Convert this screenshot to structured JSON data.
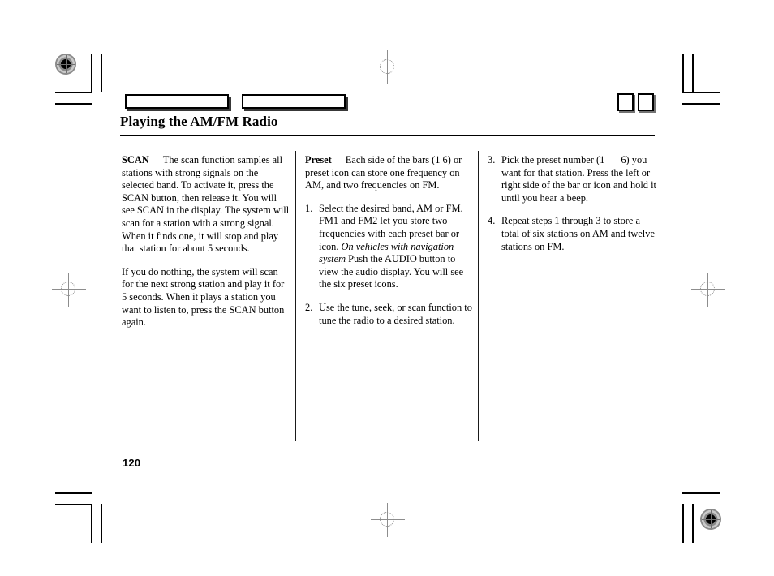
{
  "document": {
    "page_number": "120",
    "header": {
      "title": "Playing the AM/FM Radio",
      "tab_bars": [
        "",
        ""
      ],
      "corner_boxes": [
        "",
        ""
      ]
    }
  },
  "columns": [
    {
      "id": "column-1",
      "blocks": [
        {
          "type": "lead-paragraph",
          "lead": "SCAN",
          "text": "The scan function samples all stations with strong signals on the selected band. To activate it, press the SCAN button, then release it. You will see SCAN in the display. The system will scan for a station with a strong signal. When it finds one, it will stop and play that station for about 5 seconds."
        },
        {
          "type": "paragraph",
          "text": "If you do nothing, the system will scan for the next strong station and play it for 5 seconds. When it plays a station you want to listen to, press the SCAN button again."
        }
      ]
    },
    {
      "id": "column-2",
      "blocks": [
        {
          "type": "lead-paragraph",
          "lead": "Preset",
          "text": "Each side of the bars (1       6) or preset icon can store one frequency on AM, and two frequencies on FM."
        },
        {
          "type": "numbered-item",
          "number": "1.",
          "text": "Select the desired band, AM or FM. FM1 and FM2 let you store two frequencies with each preset bar or icon.",
          "italic_note": "On vehicles with navigation system",
          "text_after": "Push the AUDIO button to view the audio display. You will see the six preset icons."
        },
        {
          "type": "numbered-item",
          "number": "2.",
          "text": "Use the tune, seek, or scan function to tune the radio to a desired station."
        }
      ]
    },
    {
      "id": "column-3",
      "blocks": [
        {
          "type": "numbered-item",
          "number": "3.",
          "text_before": "Pick the preset number (1",
          "text_after": "6) you want for that station. Press the left or right side of the bar or icon and hold it until you hear a beep."
        },
        {
          "type": "numbered-item",
          "number": "4.",
          "text": "Repeat steps 1 through 3 to store a total of six stations on AM and twelve stations on FM."
        }
      ]
    }
  ]
}
